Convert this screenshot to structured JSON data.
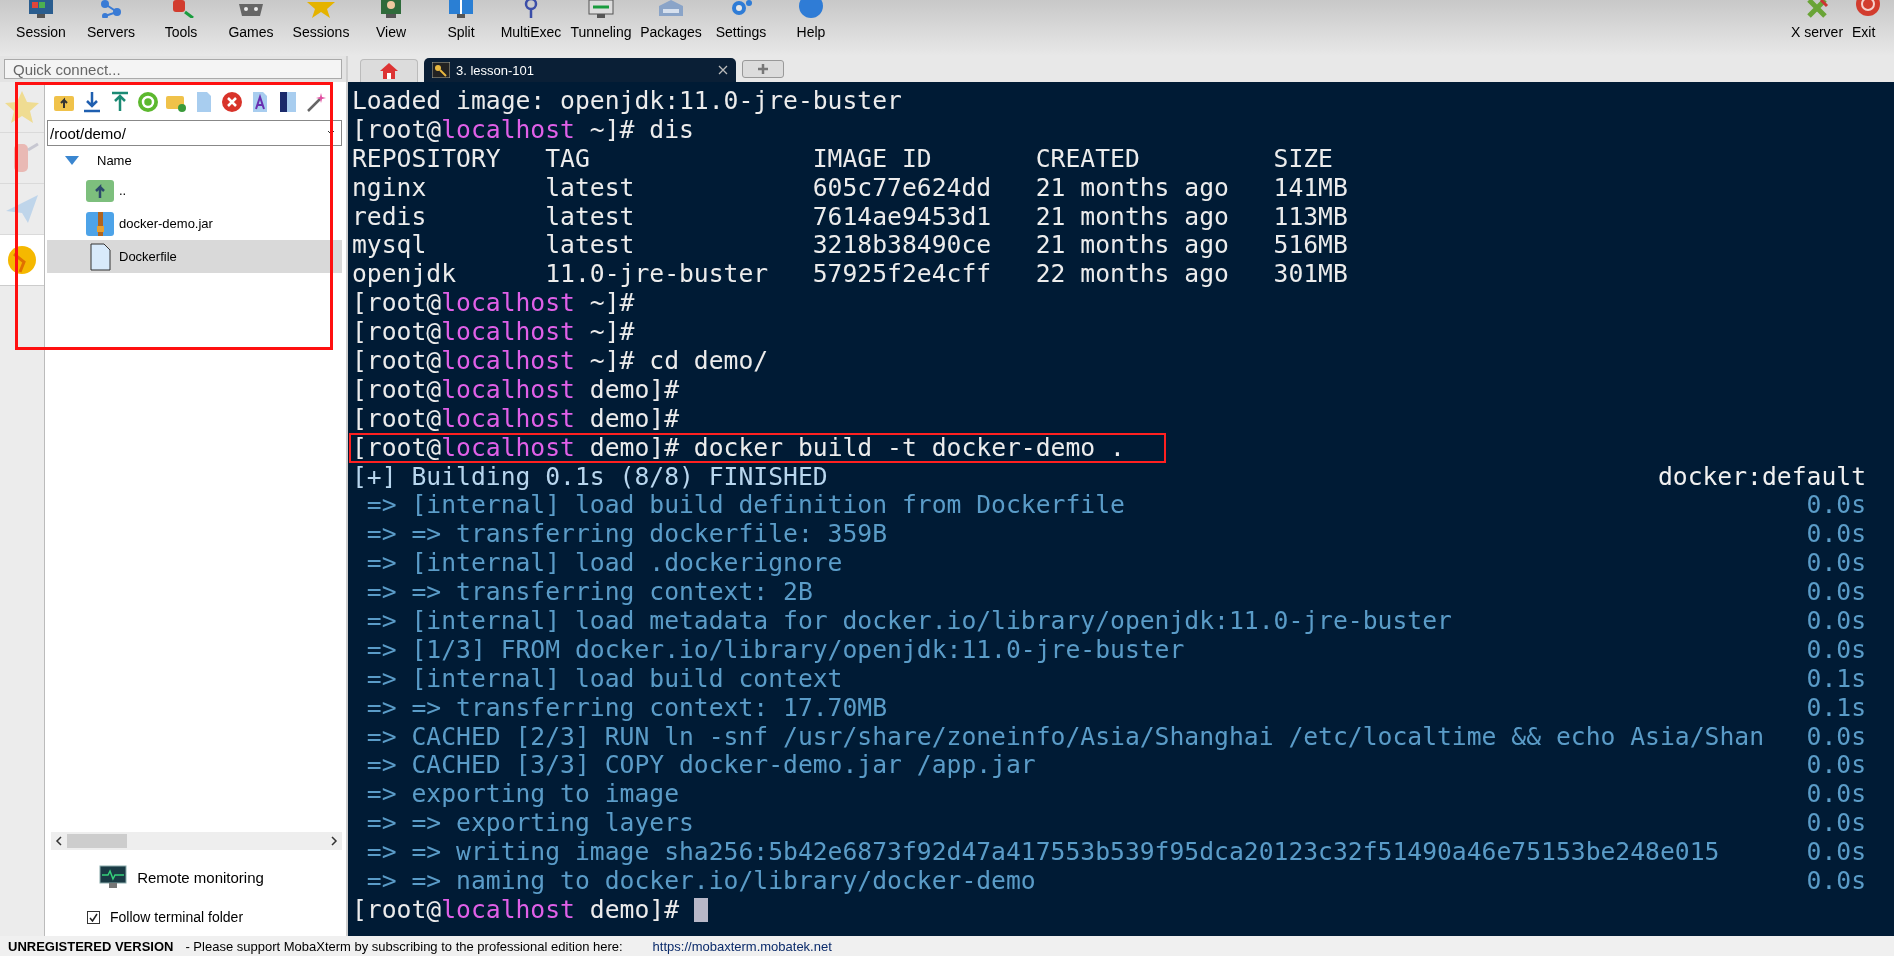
{
  "toolbar": {
    "items": [
      {
        "label": "Session"
      },
      {
        "label": "Servers"
      },
      {
        "label": "Tools"
      },
      {
        "label": "Games"
      },
      {
        "label": "Sessions"
      },
      {
        "label": "View"
      },
      {
        "label": "Split"
      },
      {
        "label": "MultiExec"
      },
      {
        "label": "Tunneling"
      },
      {
        "label": "Packages"
      },
      {
        "label": "Settings"
      },
      {
        "label": "Help"
      }
    ],
    "right_items": [
      {
        "label": "X server"
      },
      {
        "label": "Exit"
      }
    ]
  },
  "quick_connect": {
    "placeholder": "Quick connect..."
  },
  "side_tabs": [
    {
      "selected": false
    },
    {
      "selected": false
    },
    {
      "selected": false
    },
    {
      "selected": true
    }
  ],
  "file_browser": {
    "highlighted": true,
    "path": "/root/demo/",
    "column": "Name",
    "items": [
      {
        "kind": "parent",
        "name": "..",
        "selected": false
      },
      {
        "kind": "archive",
        "name": "docker-demo.jar",
        "selected": false
      },
      {
        "kind": "file",
        "name": "Dockerfile",
        "selected": true
      }
    ],
    "remote_monitoring": "Remote monitoring",
    "follow_terminal_folder": {
      "label": "Follow terminal folder",
      "checked": true
    }
  },
  "tabs": [
    {
      "kind": "home",
      "selected": false
    },
    {
      "kind": "session",
      "label": "3. lesson-101",
      "selected": true
    },
    {
      "kind": "new",
      "selected": false
    }
  ],
  "terminal": {
    "lines": [
      {
        "kind": "output",
        "text": "Loaded image: openjdk:11.0-jre-buster"
      },
      {
        "kind": "prompt",
        "user": "[root@",
        "host": "localhost",
        "rest": " ~]# dis",
        "highlighted": false,
        "cursor": false
      },
      {
        "kind": "output",
        "text": "REPOSITORY   TAG               IMAGE ID       CREATED         SIZE"
      },
      {
        "kind": "output",
        "text": "nginx        latest            605c77e624dd   21 months ago   141MB"
      },
      {
        "kind": "output",
        "text": "redis        latest            7614ae9453d1   21 months ago   113MB"
      },
      {
        "kind": "output",
        "text": "mysql        latest            3218b38490ce   21 months ago   516MB"
      },
      {
        "kind": "output",
        "text": "openjdk      11.0-jre-buster   57925f2e4cff   22 months ago   301MB"
      },
      {
        "kind": "prompt",
        "user": "[root@",
        "host": "localhost",
        "rest": " ~]#",
        "highlighted": false,
        "cursor": false
      },
      {
        "kind": "prompt",
        "user": "[root@",
        "host": "localhost",
        "rest": " ~]#",
        "highlighted": false,
        "cursor": false
      },
      {
        "kind": "prompt",
        "user": "[root@",
        "host": "localhost",
        "rest": " ~]# cd demo/",
        "highlighted": false,
        "cursor": false
      },
      {
        "kind": "prompt",
        "user": "[root@",
        "host": "localhost",
        "rest": " demo]#",
        "highlighted": false,
        "cursor": false
      },
      {
        "kind": "prompt",
        "user": "[root@",
        "host": "localhost",
        "rest": " demo]#",
        "highlighted": false,
        "cursor": false
      },
      {
        "kind": "prompt",
        "user": "[root@",
        "host": "localhost",
        "rest": " demo]# docker build -t docker-demo .",
        "highlighted": true,
        "cursor": false
      },
      {
        "kind": "build_header",
        "text": "[+] Building 0.1s (8/8) FINISHED",
        "right": "docker:default"
      },
      {
        "kind": "build",
        "text": " => [internal] load build definition from Dockerfile",
        "right": "0.0s"
      },
      {
        "kind": "build",
        "text": " => => transferring dockerfile: 359B",
        "right": "0.0s"
      },
      {
        "kind": "build",
        "text": " => [internal] load .dockerignore",
        "right": "0.0s"
      },
      {
        "kind": "build",
        "text": " => => transferring context: 2B",
        "right": "0.0s"
      },
      {
        "kind": "build",
        "text": " => [internal] load metadata for docker.io/library/openjdk:11.0-jre-buster",
        "right": "0.0s"
      },
      {
        "kind": "build",
        "text": " => [1/3] FROM docker.io/library/openjdk:11.0-jre-buster",
        "right": "0.0s"
      },
      {
        "kind": "build",
        "text": " => [internal] load build context",
        "right": "0.1s"
      },
      {
        "kind": "build",
        "text": " => => transferring context: 17.70MB",
        "right": "0.1s"
      },
      {
        "kind": "build",
        "text": " => CACHED [2/3] RUN ln -snf /usr/share/zoneinfo/Asia/Shanghai /etc/localtime && echo Asia/Shan",
        "right": "0.0s"
      },
      {
        "kind": "build",
        "text": " => CACHED [3/3] COPY docker-demo.jar /app.jar",
        "right": "0.0s"
      },
      {
        "kind": "build",
        "text": " => exporting to image",
        "right": "0.0s"
      },
      {
        "kind": "build",
        "text": " => => exporting layers",
        "right": "0.0s"
      },
      {
        "kind": "build",
        "text": " => => writing image sha256:5b42e6873f92d47a417553b539f95dca20123c32f51490a46e75153be248e015",
        "right": "0.0s"
      },
      {
        "kind": "build",
        "text": " => => naming to docker.io/library/docker-demo",
        "right": "0.0s"
      },
      {
        "kind": "prompt",
        "user": "[root@",
        "host": "localhost",
        "rest": " demo]# ",
        "highlighted": false,
        "cursor": true
      }
    ]
  },
  "status_bar": {
    "title": "UNREGISTERED VERSION",
    "message": "-  Please support MobaXterm by subscribing to the professional edition here:",
    "link": "https://mobaxterm.mobatek.net"
  }
}
